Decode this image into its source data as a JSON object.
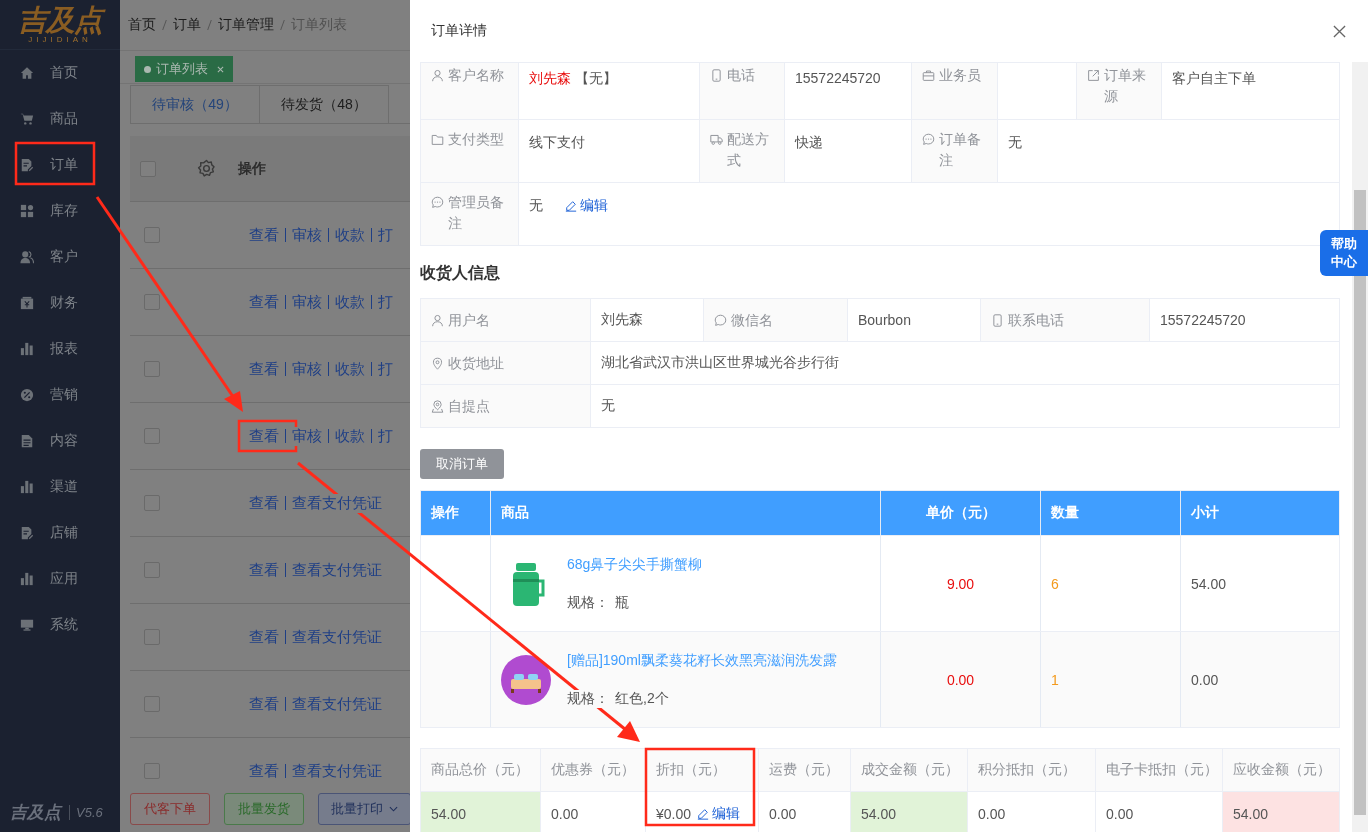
{
  "logo": {
    "text": "吉及点",
    "subtitle": "JIJIDIAN"
  },
  "sidebar": {
    "items": [
      {
        "label": "首页",
        "selected": false
      },
      {
        "label": "商品",
        "selected": false
      },
      {
        "label": "订单",
        "selected": false
      },
      {
        "label": "库存",
        "selected": false
      },
      {
        "label": "客户",
        "selected": false
      },
      {
        "label": "财务",
        "selected": false
      },
      {
        "label": "报表",
        "selected": false
      },
      {
        "label": "营销",
        "selected": false
      },
      {
        "label": "内容",
        "selected": false
      },
      {
        "label": "渠道",
        "selected": false
      },
      {
        "label": "店铺",
        "selected": false
      },
      {
        "label": "应用",
        "selected": false
      },
      {
        "label": "系统",
        "selected": false
      }
    ],
    "footer_logo": "吉及点",
    "version": "V5.6"
  },
  "breadcrumb": [
    "首页",
    "订单",
    "订单管理",
    "订单列表"
  ],
  "page_tabs": [
    {
      "label": "订单列表",
      "selected": true
    }
  ],
  "status_tabs": [
    {
      "label": "待审核（49）",
      "selected": true
    },
    {
      "label": "待发货（48）",
      "selected": false
    }
  ],
  "order_table": {
    "column": "操作",
    "header_checked": false,
    "rows": [
      {
        "checked": false,
        "actions": [
          "查看",
          "审核",
          "收款",
          "打"
        ]
      },
      {
        "checked": false,
        "actions": [
          "查看",
          "审核",
          "收款",
          "打"
        ]
      },
      {
        "checked": false,
        "actions": [
          "查看",
          "审核",
          "收款",
          "打"
        ]
      },
      {
        "checked": false,
        "actions": [
          "查看",
          "审核",
          "收款",
          "打"
        ]
      },
      {
        "checked": false,
        "actions": [
          "查看",
          "查看支付凭证"
        ]
      },
      {
        "checked": false,
        "actions": [
          "查看",
          "查看支付凭证"
        ]
      },
      {
        "checked": false,
        "actions": [
          "查看",
          "查看支付凭证"
        ]
      },
      {
        "checked": false,
        "actions": [
          "查看",
          "查看支付凭证"
        ]
      },
      {
        "checked": false,
        "actions": [
          "查看",
          "查看支付凭证"
        ]
      }
    ]
  },
  "footer_buttons": [
    {
      "label": "代客下单",
      "kind": "danger"
    },
    {
      "label": "批量发货",
      "kind": "success"
    },
    {
      "label": "批量打印",
      "kind": "dropdown"
    }
  ],
  "drawer": {
    "title": "订单详情",
    "order_info": [
      [
        {
          "label": "客户名称",
          "value": "刘先森",
          "value_note": "【无】",
          "highlight": true
        },
        {
          "label": "电话",
          "value": "15572245720"
        },
        {
          "label": "业务员"
        },
        {
          "label": "订单来源",
          "value": "客户自主下单"
        }
      ],
      [
        {
          "label": "支付类型",
          "value": "线下支付"
        },
        {
          "label": "配送方式",
          "value": "快递"
        },
        {
          "label": "订单备注",
          "value": "无"
        }
      ],
      [
        {
          "label": "管理员备注",
          "value": "无",
          "link": "编辑"
        }
      ]
    ],
    "receiver_title": "收货人信息",
    "receiver_info": [
      [
        {
          "label": "用户名",
          "value": "刘先森"
        },
        {
          "label": "微信名",
          "value": "Bourbon"
        },
        {
          "label": "联系电话",
          "value": "15572245720"
        }
      ],
      [
        {
          "label": "收货地址",
          "value": "湖北省武汉市洪山区世界城光谷步行街"
        }
      ],
      [
        {
          "label": "自提点",
          "value": "无"
        }
      ]
    ],
    "cancel_button": "取消订单",
    "goods_table": {
      "columns": [
        "操作",
        "商品",
        "单价（元）",
        "数量",
        "小计"
      ],
      "rows": [
        {
          "name": "68g鼻子尖尖手撕蟹柳",
          "spec_label": "规格：",
          "spec": "瓶",
          "price": "9.00",
          "quantity": "6",
          "subtotal": "54.00"
        },
        {
          "name": "[赠品]190ml飘柔葵花籽长效黑亮滋润洗发露",
          "spec_label": "规格：",
          "spec": "红色,2个",
          "price": "0.00",
          "quantity": "1",
          "subtotal": "0.00"
        }
      ]
    },
    "summary": [
      {
        "label": "商品总价（元）",
        "value": "54.00",
        "color": "#e1f3d8"
      },
      {
        "label": "优惠券（元）",
        "value": "0.00"
      },
      {
        "label": "折扣（元）",
        "value": "¥0.00",
        "link": "编辑"
      },
      {
        "label": "运费（元）",
        "value": "0.00"
      },
      {
        "label": "成交金额（元）",
        "value": "54.00",
        "color": "#e1f3d8"
      },
      {
        "label": "积分抵扣（元）",
        "value": "0.00"
      },
      {
        "label": "电子卡抵扣（元）",
        "value": "0.00"
      },
      {
        "label": "应收金额（元）",
        "value": "54.00",
        "color": "#fde2e2"
      }
    ]
  },
  "help_button": "帮助中心"
}
